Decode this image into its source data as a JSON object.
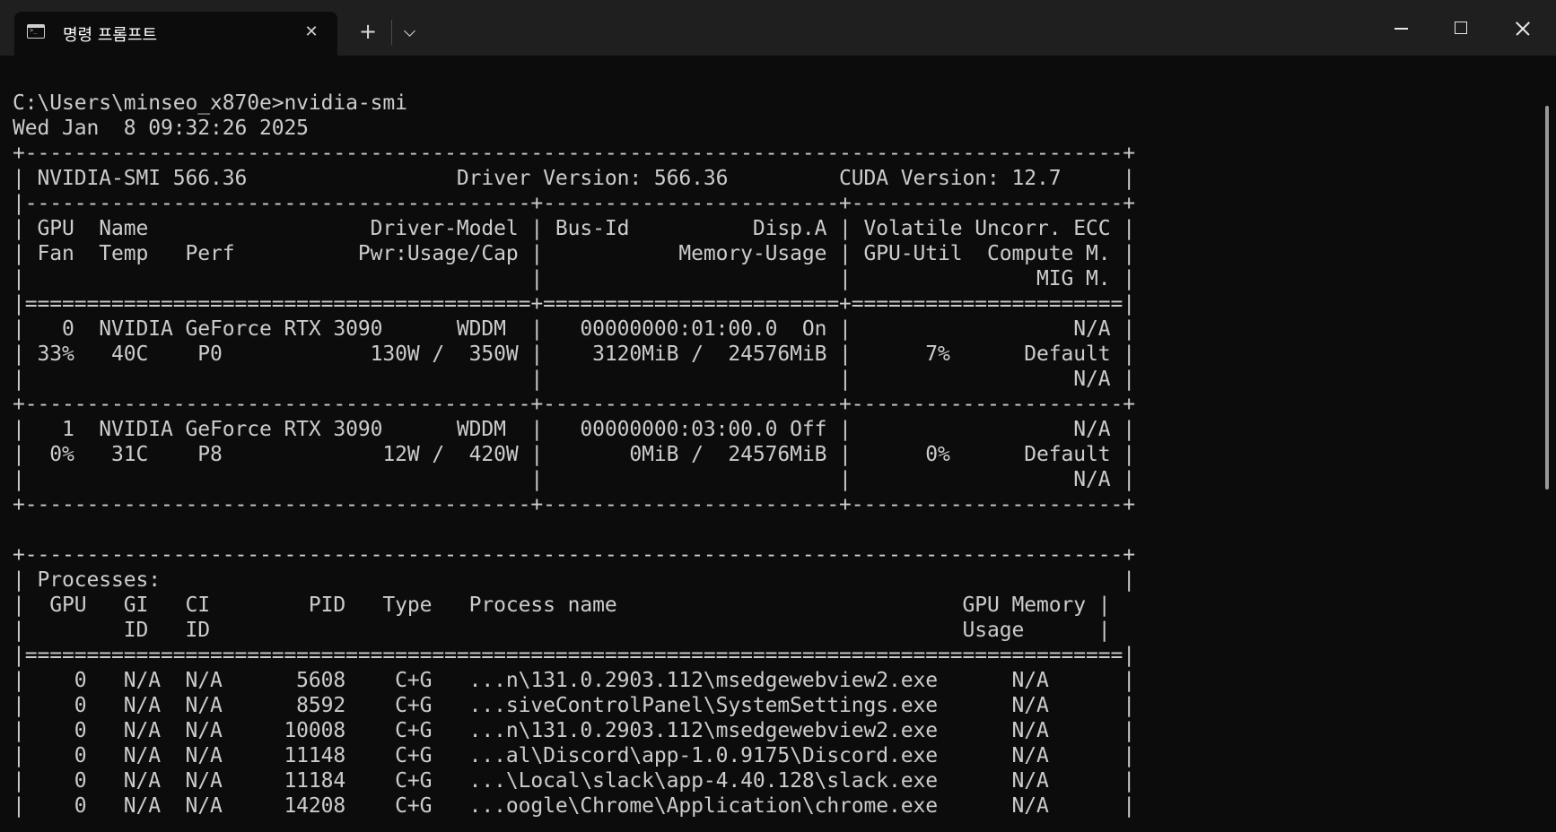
{
  "window": {
    "tab_title": "명령 프롬프트",
    "tab_icon": "terminal-icon",
    "tab_close": "✕",
    "new_tab": "+",
    "dropdown_icon": "chevron-down-icon"
  },
  "terminal": {
    "lines": [
      "C:\\Users\\minseo_x870e>nvidia-smi",
      "Wed Jan  8 09:32:26 2025",
      "+-----------------------------------------------------------------------------------------+",
      "| NVIDIA-SMI 566.36                 Driver Version: 566.36         CUDA Version: 12.7     |",
      "|-----------------------------------------+------------------------+----------------------+",
      "| GPU  Name                  Driver-Model | Bus-Id          Disp.A | Volatile Uncorr. ECC |",
      "| Fan  Temp   Perf          Pwr:Usage/Cap |           Memory-Usage | GPU-Util  Compute M. |",
      "|                                         |                        |               MIG M. |",
      "|=========================================+========================+======================|",
      "|   0  NVIDIA GeForce RTX 3090      WDDM  |   00000000:01:00.0  On |                  N/A |",
      "| 33%   40C    P0            130W /  350W |    3120MiB /  24576MiB |      7%      Default |",
      "|                                         |                        |                  N/A |",
      "+-----------------------------------------+------------------------+----------------------+",
      "|   1  NVIDIA GeForce RTX 3090      WDDM  |   00000000:03:00.0 Off |                  N/A |",
      "|  0%   31C    P8             12W /  420W |       0MiB /  24576MiB |      0%      Default |",
      "|                                         |                        |                  N/A |",
      "+-----------------------------------------+------------------------+----------------------+",
      "",
      "+-----------------------------------------------------------------------------------------+",
      "| Processes:                                                                              |",
      "|  GPU   GI   CI        PID   Type   Process name                            GPU Memory |",
      "|        ID   ID                                                             Usage      |",
      "|=========================================================================================|",
      "|    0   N/A  N/A      5608    C+G   ...n\\131.0.2903.112\\msedgewebview2.exe      N/A      |",
      "|    0   N/A  N/A      8592    C+G   ...siveControlPanel\\SystemSettings.exe      N/A      |",
      "|    0   N/A  N/A     10008    C+G   ...n\\131.0.2903.112\\msedgewebview2.exe      N/A      |",
      "|    0   N/A  N/A     11148    C+G   ...al\\Discord\\app-1.0.9175\\Discord.exe      N/A      |",
      "|    0   N/A  N/A     11184    C+G   ...\\Local\\slack\\app-4.40.128\\slack.exe      N/A      |",
      "|    0   N/A  N/A     14208    C+G   ...oogle\\Chrome\\Application\\chrome.exe      N/A      |"
    ]
  }
}
